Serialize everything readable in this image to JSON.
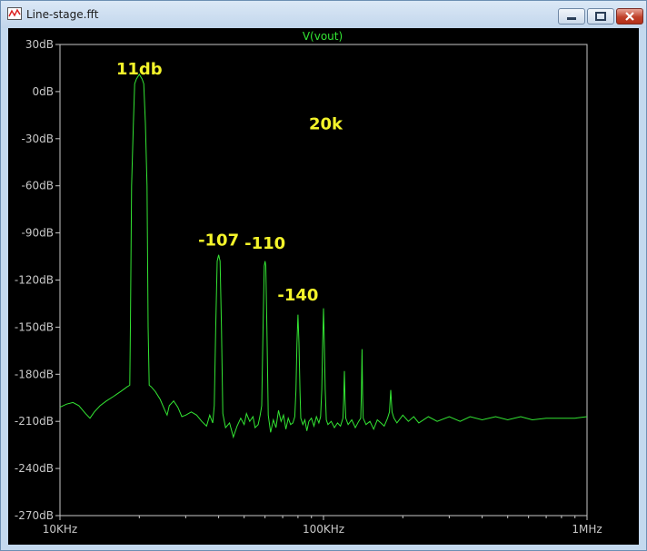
{
  "window": {
    "title": "Line-stage.fft",
    "app_icon": "waveform-icon",
    "controls": [
      "minimize-icon",
      "maximize-icon",
      "close-icon"
    ]
  },
  "colors": {
    "background": "#000000",
    "trace": "#33e533",
    "annotation": "#f3f32a",
    "axis": "#c8c8c8"
  },
  "chart_data": {
    "type": "line",
    "title": "V(vout)",
    "xlabel": "",
    "ylabel": "",
    "xscale": "log",
    "xlim": [
      10000,
      1000000
    ],
    "ylim": [
      -270,
      30
    ],
    "grid": false,
    "x_ticks": [
      {
        "value": 10000,
        "label": "10KHz"
      },
      {
        "value": 100000,
        "label": "100KHz"
      },
      {
        "value": 1000000,
        "label": "1MHz"
      }
    ],
    "y_ticks": [
      {
        "value": 30,
        "label": "30dB"
      },
      {
        "value": 0,
        "label": "0dB"
      },
      {
        "value": -30,
        "label": "-30dB"
      },
      {
        "value": -60,
        "label": "-60dB"
      },
      {
        "value": -90,
        "label": "-90dB"
      },
      {
        "value": -120,
        "label": "-120dB"
      },
      {
        "value": -150,
        "label": "-150dB"
      },
      {
        "value": -180,
        "label": "-180dB"
      },
      {
        "value": -210,
        "label": "-210dB"
      },
      {
        "value": -240,
        "label": "-240dB"
      },
      {
        "value": -270,
        "label": "-270dB"
      }
    ],
    "annotations": [
      {
        "text": "11db",
        "x": 20000,
        "y": 11
      },
      {
        "text": "20k",
        "x": 102000,
        "y": -24
      },
      {
        "text": "-107",
        "x": 40000,
        "y": -98
      },
      {
        "text": "-110",
        "x": 60000,
        "y": -100
      },
      {
        "text": "-140",
        "x": 80000,
        "y": -133
      }
    ],
    "series": [
      {
        "name": "V(vout)",
        "points": [
          [
            10000,
            -201
          ],
          [
            10600,
            -199
          ],
          [
            11200,
            -198
          ],
          [
            11800,
            -200
          ],
          [
            12500,
            -205
          ],
          [
            13000,
            -208
          ],
          [
            13500,
            -204
          ],
          [
            14200,
            -200
          ],
          [
            15000,
            -197
          ],
          [
            16000,
            -194
          ],
          [
            17000,
            -191
          ],
          [
            18000,
            -188
          ],
          [
            18400,
            -187
          ],
          [
            18500,
            -150
          ],
          [
            18700,
            -60
          ],
          [
            19000,
            -20
          ],
          [
            19200,
            5
          ],
          [
            19500,
            8
          ],
          [
            20000,
            11
          ],
          [
            20500,
            8
          ],
          [
            20800,
            5
          ],
          [
            21100,
            -20
          ],
          [
            21400,
            -60
          ],
          [
            21600,
            -150
          ],
          [
            21800,
            -187
          ],
          [
            22200,
            -188
          ],
          [
            23000,
            -191
          ],
          [
            24000,
            -196
          ],
          [
            25000,
            -203
          ],
          [
            25500,
            -206
          ],
          [
            26000,
            -200
          ],
          [
            27000,
            -197
          ],
          [
            28000,
            -201
          ],
          [
            29000,
            -207
          ],
          [
            30000,
            -206
          ],
          [
            31500,
            -204
          ],
          [
            33000,
            -206
          ],
          [
            34500,
            -210
          ],
          [
            36000,
            -213
          ],
          [
            37000,
            -206
          ],
          [
            38000,
            -211
          ],
          [
            38500,
            -200
          ],
          [
            39000,
            -150
          ],
          [
            39500,
            -108
          ],
          [
            40000,
            -104
          ],
          [
            40500,
            -108
          ],
          [
            41000,
            -150
          ],
          [
            41500,
            -205
          ],
          [
            42500,
            -214
          ],
          [
            44000,
            -211
          ],
          [
            45500,
            -220
          ],
          [
            47000,
            -213
          ],
          [
            48500,
            -208
          ],
          [
            50000,
            -212
          ],
          [
            51000,
            -205
          ],
          [
            52500,
            -210
          ],
          [
            54000,
            -207
          ],
          [
            55000,
            -214
          ],
          [
            56500,
            -212
          ],
          [
            57500,
            -206
          ],
          [
            58300,
            -200
          ],
          [
            59000,
            -150
          ],
          [
            59600,
            -111
          ],
          [
            60000,
            -108
          ],
          [
            60400,
            -111
          ],
          [
            61000,
            -150
          ],
          [
            61700,
            -206
          ],
          [
            63000,
            -217
          ],
          [
            64500,
            -209
          ],
          [
            66000,
            -214
          ],
          [
            67500,
            -203
          ],
          [
            69000,
            -210
          ],
          [
            70500,
            -206
          ],
          [
            72000,
            -215
          ],
          [
            73500,
            -208
          ],
          [
            75000,
            -212
          ],
          [
            76500,
            -211
          ],
          [
            77800,
            -207
          ],
          [
            78600,
            -190
          ],
          [
            79300,
            -160
          ],
          [
            80000,
            -142
          ],
          [
            80700,
            -160
          ],
          [
            81400,
            -190
          ],
          [
            82000,
            -208
          ],
          [
            83500,
            -212
          ],
          [
            85000,
            -209
          ],
          [
            86500,
            -216
          ],
          [
            88000,
            -210
          ],
          [
            90000,
            -208
          ],
          [
            92000,
            -213
          ],
          [
            94000,
            -207
          ],
          [
            96000,
            -211
          ],
          [
            97500,
            -207
          ],
          [
            98500,
            -190
          ],
          [
            99300,
            -160
          ],
          [
            100000,
            -138
          ],
          [
            100700,
            -160
          ],
          [
            101500,
            -190
          ],
          [
            102500,
            -209
          ],
          [
            104000,
            -212
          ],
          [
            107000,
            -210
          ],
          [
            110000,
            -214
          ],
          [
            113000,
            -211
          ],
          [
            116000,
            -213
          ],
          [
            118500,
            -208
          ],
          [
            119300,
            -196
          ],
          [
            120000,
            -178
          ],
          [
            120700,
            -196
          ],
          [
            121500,
            -208
          ],
          [
            124000,
            -212
          ],
          [
            128000,
            -209
          ],
          [
            132000,
            -214
          ],
          [
            136000,
            -210
          ],
          [
            138500,
            -208
          ],
          [
            139300,
            -192
          ],
          [
            140000,
            -164
          ],
          [
            140700,
            -192
          ],
          [
            141500,
            -208
          ],
          [
            145000,
            -212
          ],
          [
            150000,
            -210
          ],
          [
            155000,
            -215
          ],
          [
            160000,
            -209
          ],
          [
            165000,
            -211
          ],
          [
            170000,
            -213
          ],
          [
            175000,
            -208
          ],
          [
            178000,
            -204
          ],
          [
            180000,
            -190
          ],
          [
            182000,
            -204
          ],
          [
            185000,
            -208
          ],
          [
            190000,
            -211
          ],
          [
            200000,
            -206
          ],
          [
            210000,
            -210
          ],
          [
            220000,
            -207
          ],
          [
            230000,
            -211
          ],
          [
            250000,
            -207
          ],
          [
            270000,
            -210
          ],
          [
            300000,
            -207
          ],
          [
            330000,
            -210
          ],
          [
            360000,
            -207
          ],
          [
            400000,
            -209
          ],
          [
            450000,
            -207
          ],
          [
            500000,
            -209
          ],
          [
            560000,
            -207
          ],
          [
            620000,
            -209
          ],
          [
            700000,
            -208
          ],
          [
            800000,
            -208
          ],
          [
            900000,
            -208
          ],
          [
            1000000,
            -207
          ]
        ]
      }
    ]
  }
}
